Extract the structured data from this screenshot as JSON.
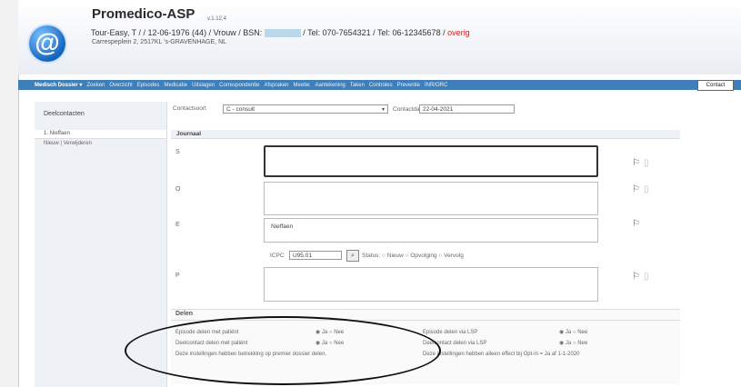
{
  "header": {
    "app_title": "Promedico-ASP",
    "version": "v.1.12.4",
    "patient_name": "Tour-Easy, T / / 12-06-1976 (44) / Vrouw / BSN:",
    "patient_phones": "/ Tel: 070-7654321 / Tel: 06-12345678 /",
    "patient_flag": "overig",
    "address": "Carrespeplein 2, 2517KL 's-GRAVENHAGE, NL"
  },
  "nav": {
    "items": [
      "Medisch Dossier ▾",
      "Zoeken",
      "Overzicht",
      "Episodes",
      "Medicatie",
      "Uitslagen",
      "Correspondentie",
      "Afspraken",
      "Meetw.",
      "Aantekening",
      "Taken",
      "Controles",
      "Preventie",
      "INR/ORC"
    ],
    "active": "Contact"
  },
  "sidebar": {
    "title": "Deelcontacten",
    "tab_label": "1. Nieffaen",
    "row_text": "Nieuw  |  Verwijderen"
  },
  "contact_form": {
    "contactsoort_label": "Contactsoort",
    "contactsoort_value": "C - consult",
    "contactdatum_label": "Contactdatum",
    "contactdatum_value": "22-04-2021"
  },
  "journal": {
    "title": "Journaal",
    "s_label": "S",
    "o_label": "O",
    "e_label": "E",
    "p_label": "P",
    "e_value": "Nieffaen",
    "icpc_label": "ICPC",
    "icpc_value": "U95.01",
    "status_text": "Status:  ○ Nieuw  ○ Opvolging  ○ Vervolg"
  },
  "delen": {
    "title": "Delen",
    "row1_label": "Episode delen met patiënt",
    "row2_label": "Deelcontact delen met patiënt",
    "row3_label": "Deze instellingen hebben betrekking op premier dossier delen.",
    "row1_right_label": "Episode delen via LSP",
    "row2_right_label": "Deelcontact delen via LSP",
    "row3_right_label": "Deze instellingen hebben alleen effect bij Opt-in = Ja af 1-1-2020",
    "yes": "Ja",
    "no": "Nee"
  }
}
